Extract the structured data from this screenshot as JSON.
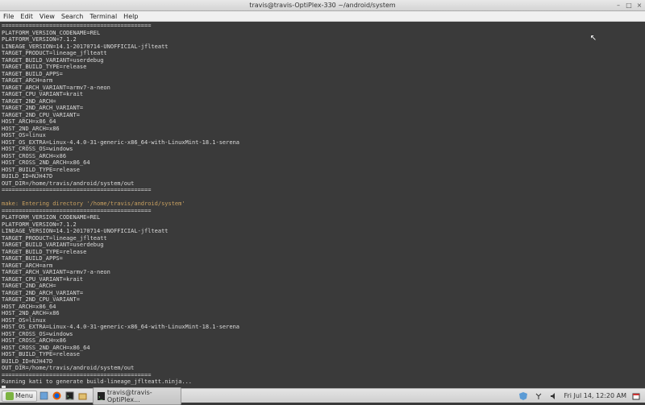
{
  "window": {
    "title": "travis@travis-OptiPlex-330 ~/android/system",
    "controls": {
      "minimize": "–",
      "maximize": "□",
      "close": "×"
    }
  },
  "menubar": [
    "File",
    "Edit",
    "View",
    "Search",
    "Terminal",
    "Help"
  ],
  "terminal": {
    "sep": "============================================",
    "b1": {
      "l1": "PLATFORM_VERSION_CODENAME=REL",
      "l2": "PLATFORM_VERSION=7.1.2",
      "l3": "LINEAGE_VERSION=14.1-20170714-UNOFFICIAL-jflteatt",
      "l4": "TARGET_PRODUCT=lineage_jflteatt",
      "l5": "TARGET_BUILD_VARIANT=userdebug",
      "l6": "TARGET_BUILD_TYPE=release",
      "l7": "TARGET_BUILD_APPS=",
      "l8": "TARGET_ARCH=arm",
      "l9": "TARGET_ARCH_VARIANT=armv7-a-neon",
      "l10": "TARGET_CPU_VARIANT=krait",
      "l11": "TARGET_2ND_ARCH=",
      "l12": "TARGET_2ND_ARCH_VARIANT=",
      "l13": "TARGET_2ND_CPU_VARIANT=",
      "l14": "HOST_ARCH=x86_64",
      "l15": "HOST_2ND_ARCH=x86",
      "l16": "HOST_OS=linux",
      "l17": "HOST_OS_EXTRA=Linux-4.4.0-31-generic-x86_64-with-LinuxMint-18.1-serena",
      "l18": "HOST_CROSS_OS=windows",
      "l19": "HOST_CROSS_ARCH=x86",
      "l20": "HOST_CROSS_2ND_ARCH=x86_64",
      "l21": "HOST_BUILD_TYPE=release",
      "l22": "BUILD_ID=NJH47D",
      "l23": "OUT_DIR=/home/travis/android/system/out"
    },
    "make": "make: Entering directory '/home/travis/android/system'",
    "kati": "Running kati to generate build-lineage_jflteatt.ninja..."
  },
  "panel": {
    "menu_label": "Menu",
    "task_label": "travis@travis-OptiPlex...",
    "clock": "Fri Jul 14, 12:20 AM"
  },
  "icons": {
    "mint": "mint-logo",
    "desktop": "desktop-icon",
    "firefox": "firefox-icon",
    "terminal": "terminal-icon",
    "files": "files-icon",
    "shield": "shield-icon",
    "network": "network-icon",
    "volume": "volume-icon",
    "calendar": "calendar-icon"
  }
}
